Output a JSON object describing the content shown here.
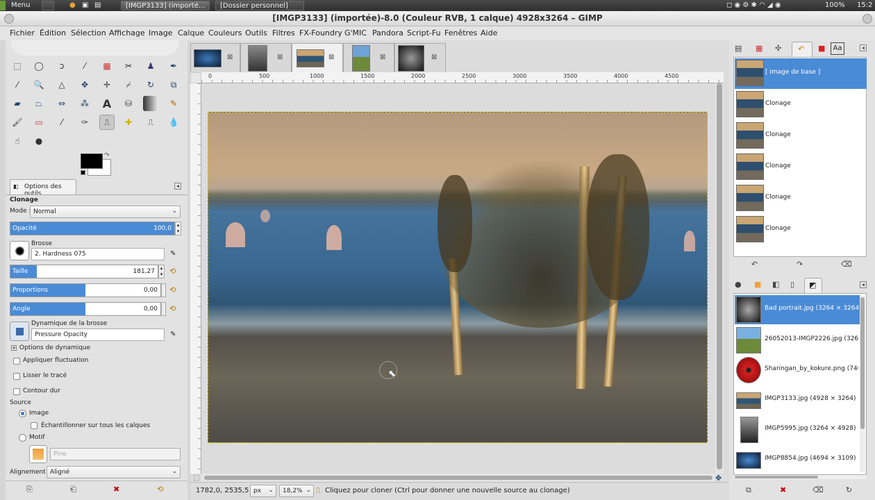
{
  "system_panel": {
    "apps_label": "Menu",
    "tasks": [
      "[IMGP3133] (importé...",
      "[Dossier personnel]"
    ],
    "battery": "100%",
    "clock": "15:2"
  },
  "window": {
    "title": "[IMGP3133] (importée)-8.0 (Couleur RVB, 1 calque) 4928x3264 – GIMP"
  },
  "menu": [
    "Fichier",
    "Édition",
    "Sélection",
    "Affichage",
    "Image",
    "Calque",
    "Couleurs",
    "Outils",
    "Filtres",
    "FX-Foundry",
    "G'MIC",
    "Pandora",
    "Script-Fu",
    "Fenêtres",
    "Aide"
  ],
  "tool_options": {
    "tab_label": "Options des outils",
    "tool_name": "Clonage",
    "mode_label": "Mode :",
    "mode_value": "Normal",
    "opacity_label": "Opacité",
    "opacity_value": "100,0",
    "opacity_fraction": 1.0,
    "brush_label": "Brosse",
    "brush_value": "2. Hardness 075",
    "size_label": "Taille",
    "size_value": "181,27",
    "size_fraction": 0.18,
    "aspect_label": "Proportions",
    "aspect_value": "0,00",
    "aspect_fraction": 0.5,
    "angle_label": "Angle",
    "angle_value": "0,00",
    "angle_fraction": 0.5,
    "dynamics_label": "Dynamique de la brosse",
    "dynamics_value": "Pressure Opacity",
    "dyn_options_label": "Options de dynamique",
    "jitter_label": "Appliquer fluctuation",
    "smooth_label": "Lisser le tracé",
    "hard_edge_label": "Contour dur",
    "source_label": "Source",
    "source_image_label": "Image",
    "sample_merged_label": "Échantillonner sur tous les calques",
    "source_pattern_label": "Motif",
    "pattern_placeholder": "Pine",
    "alignment_label": "Alignement :",
    "alignment_value": "Aligné"
  },
  "rulers": {
    "h_ticks": [
      "0",
      "500",
      "1000",
      "1500",
      "2000",
      "2500",
      "3000",
      "3500",
      "4000",
      "4500"
    ]
  },
  "status": {
    "coords": "1782,0, 2535,5",
    "unit": "px",
    "zoom": "18,2%",
    "message": "Cliquez pour cloner (Ctrl pour donner une nouvelle source au clonage)"
  },
  "layers": [
    {
      "name": "[ image de base ]",
      "selected": true
    },
    {
      "name": "Clonage",
      "selected": false
    },
    {
      "name": "Clonage",
      "selected": false
    },
    {
      "name": "Clonage",
      "selected": false
    },
    {
      "name": "Clonage",
      "selected": false
    },
    {
      "name": "Clonage",
      "selected": false
    }
  ],
  "images": [
    {
      "name": "Bad portrait.jpg (3264 × 3264)",
      "selected": true
    },
    {
      "name": "26052013-IMGP2226.jpg (3264 × 4",
      "selected": false
    },
    {
      "name": "Sharingan_by_kokure.png (746 × 7",
      "selected": false
    },
    {
      "name": "IMGP3133.jpg (4928 × 3264)",
      "selected": false
    },
    {
      "name": "IMGP5995.jpg (3264 × 4928)",
      "selected": false
    },
    {
      "name": "IMGP8854.jpg (4694 × 3109)",
      "selected": false
    }
  ],
  "fonts_tab_label": "Aa",
  "colors": {
    "accent": "#4a8bd6",
    "foreground": "#000000",
    "background": "#ffffff"
  }
}
